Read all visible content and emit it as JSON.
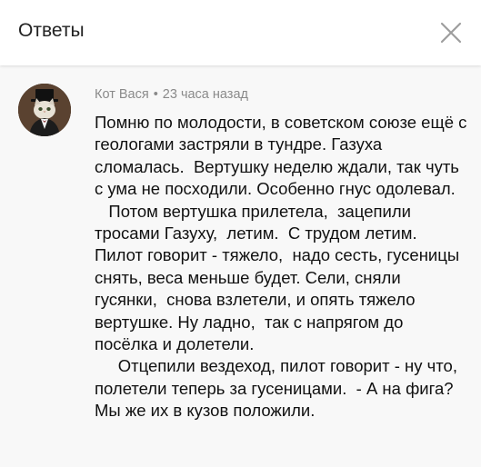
{
  "header": {
    "title": "Ответы",
    "close_icon": "close-icon"
  },
  "comment": {
    "author": "Кот Вася",
    "separator": "•",
    "time": "23 часа назад",
    "avatar_icon": "cat-avatar-icon",
    "paragraphs": [
      "Помню по молодости, в советском союзе ещё с геологами застряли в тундре. Газуха сломалась.  Вертушку неделю ждали, так чуть с ума не посходили. Особенно гнус одолевал.",
      "   Потом вертушка прилетела,  зацепили тросами Газуху,  летим.  С трудом летим. Пилот говорит - тяжело,  надо сесть, гусеницы снять, веса меньше будет. Сели, сняли гусянки,  снова взлетели, и опять тяжело вертушке. Ну ладно,  так с напрягом до посёлка и долетели.",
      "     Отцепили вездеход, пилот говорит - ну что, полетели теперь за гусеницами.  - А на фига?  Мы же их в кузов положили."
    ]
  }
}
